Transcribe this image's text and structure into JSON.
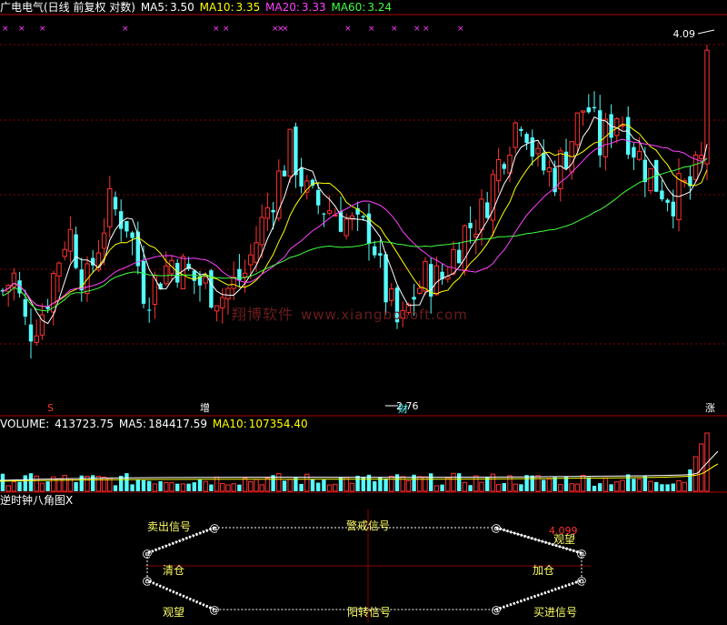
{
  "price_header": {
    "title": "广电电气(日线 前复权 对数)",
    "ma5_label": "MA5:",
    "ma5_value": "3.50",
    "ma10_label": "MA10:",
    "ma10_value": "3.35",
    "ma20_label": "MA20:",
    "ma20_value": "3.33",
    "ma60_label": "MA60:",
    "ma60_value": "3.24"
  },
  "price_annotations": {
    "high_label": "4.09",
    "low_label": "2.76",
    "event_s": "S",
    "event_zeng": "增",
    "event_cai": "财",
    "event_zhang": "涨"
  },
  "volume_header": {
    "title": "VOLUME:",
    "volume_value": "413723.75",
    "ma5_label": "MA5:",
    "ma5_value": "184417.59",
    "ma10_label": "MA10:",
    "ma10_value": "107354.40"
  },
  "indicator": {
    "title": "逆时钟八角图X",
    "sell_signal": "卖出信号",
    "warning_signal": "警戒信号",
    "watch_top": "观望",
    "watch_bottom": "观望",
    "clear_position": "清仓",
    "add_position": "加仓",
    "yang_signal": "阳转信号",
    "buy_signal": "买进信号",
    "value": "4.099",
    "node_symbol": "@"
  },
  "watermark": {
    "cn": "翔博软件",
    "url": "www.xiangbosoft.com"
  },
  "colors": {
    "up": "#ff3232",
    "down": "#54fcfc",
    "ma5": "#ffffff",
    "ma10": "#ffff00",
    "ma20": "#ff40ff",
    "ma60": "#40ff40",
    "grid": "#8b0000",
    "axis": "#b00000"
  },
  "chart_data": [
    {
      "type": "candlestick",
      "title": "广电电气(日线 前复权 对数)",
      "ylim": [
        2.7,
        4.15
      ],
      "y_scale": "log",
      "grid": true,
      "series": [
        {
          "name": "MA5",
          "last": 3.5
        },
        {
          "name": "MA10",
          "last": 3.35
        },
        {
          "name": "MA20",
          "last": 3.33
        },
        {
          "name": "MA60",
          "last": 3.24
        }
      ],
      "annotations": [
        {
          "text": "4.09",
          "value": 4.09
        },
        {
          "text": "2.76",
          "value": 2.76
        }
      ]
    },
    {
      "type": "bar",
      "title": "VOLUME",
      "series": [
        {
          "name": "VOLUME",
          "last": 413723.75
        },
        {
          "name": "MA5",
          "last": 184417.59
        },
        {
          "name": "MA10",
          "last": 107354.4
        }
      ]
    }
  ]
}
